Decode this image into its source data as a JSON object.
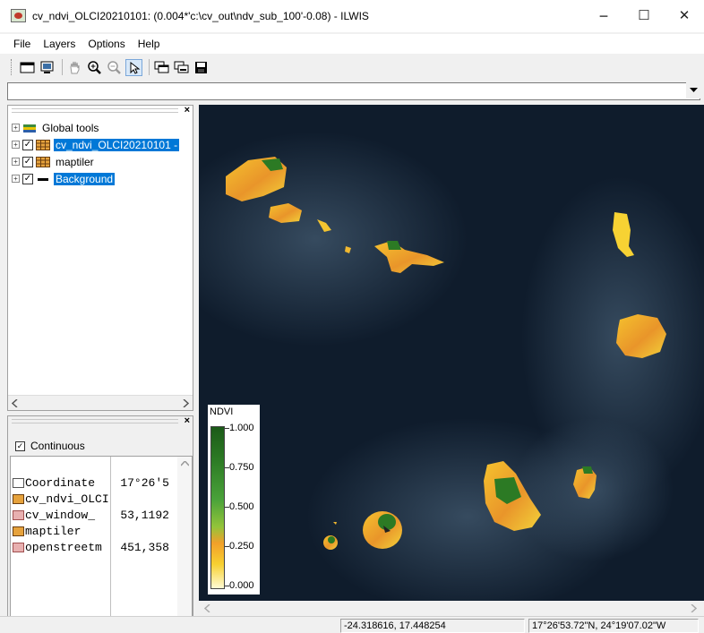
{
  "window": {
    "title": "cv_ndvi_OLCI20210101: (0.004*'c:\\cv_out\\ndv_sub_100'-0.08) - ILWIS",
    "minimize": "−",
    "maximize": "☐",
    "close": "✕"
  },
  "menu": [
    "File",
    "Layers",
    "Options",
    "Help"
  ],
  "toolbar": {
    "icons": [
      "new-map-icon",
      "display-icon",
      "pan-hand-icon",
      "zoom-in-icon",
      "zoom-out-icon",
      "select-pointer-icon",
      "add-layer-icon",
      "remove-layer-icon",
      "save-icon"
    ]
  },
  "command_line": {
    "value": ""
  },
  "layer_tree": {
    "items": [
      {
        "label": "Global tools",
        "checked": false,
        "selected": false
      },
      {
        "label": "cv_ndvi_OLCI20210101 -",
        "checked": true,
        "selected": true
      },
      {
        "label": "maptiler",
        "checked": true,
        "selected": false
      },
      {
        "label": "Background",
        "checked": true,
        "selected": true
      }
    ]
  },
  "properties": {
    "continuous_label": "Continuous",
    "continuous_checked": true,
    "rows": [
      {
        "name": "Coordinate",
        "value": "17°26'5"
      },
      {
        "name": "cv_ndvi_OLCI",
        "value": ""
      },
      {
        "name": "cv_window_",
        "value": "53,1192"
      },
      {
        "name": "maptiler",
        "value": ""
      },
      {
        "name": "openstreetm",
        "value": "451,358"
      }
    ]
  },
  "legend": {
    "title": "NDVI",
    "labels": [
      "1.000",
      "0.750",
      "0.500",
      "0.250",
      "0.000"
    ]
  },
  "status": {
    "xy": "-24.318616, 17.448254",
    "latlon": "17°26'53.72\"N, 24°19'07.02\"W"
  },
  "colors": {
    "ocean": "#0f1c2c",
    "selection": "#0078d7",
    "ndvi_low": "#f7d030",
    "ndvi_mid": "#f2a02a",
    "ndvi_high": "#2c7a24"
  }
}
